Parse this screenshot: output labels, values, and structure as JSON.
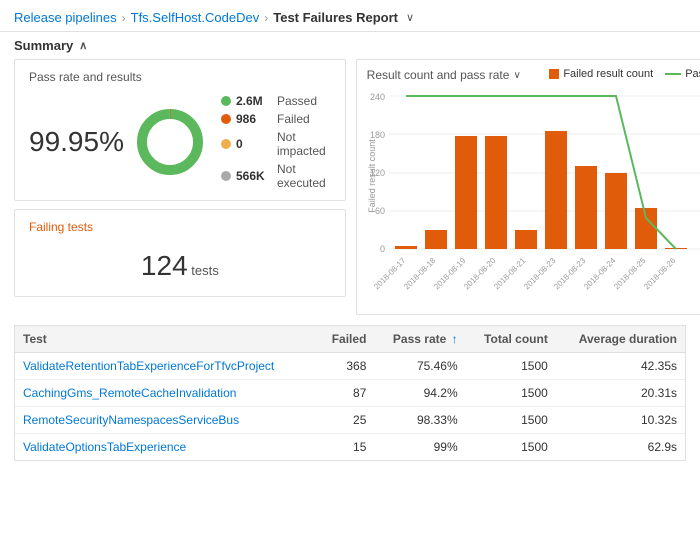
{
  "header": {
    "breadcrumb1": "Release pipelines",
    "breadcrumb2": "Tfs.SelfHost.CodeDev",
    "title": "Test Failures Report",
    "sep": "›"
  },
  "summary": {
    "label": "Summary",
    "chevron": "∧"
  },
  "passRate": {
    "title": "Pass rate and results",
    "percent": "99.95%",
    "legend": [
      {
        "color": "#5cb85c",
        "value": "2.6M",
        "label": "Passed"
      },
      {
        "color": "#e05c0a",
        "value": "986",
        "label": "Failed"
      },
      {
        "color": "#f0ad4e",
        "value": "0",
        "label": "Not impacted"
      },
      {
        "color": "#aaa",
        "value": "566K",
        "label": "Not executed"
      }
    ]
  },
  "failingTests": {
    "title": "Failing tests",
    "count": "124",
    "unit": "tests"
  },
  "chart": {
    "title": "Result count and pass rate",
    "legend": [
      {
        "type": "rect",
        "color": "#e05c0a",
        "label": "Failed result count"
      },
      {
        "type": "line",
        "color": "#5cb85c",
        "label": "Pass rate"
      }
    ],
    "yAxisLabel": "Failed result count",
    "y2AxisLabel": "",
    "bars": [
      {
        "date": "2018-08-17",
        "value": 5
      },
      {
        "date": "2018-08-18",
        "value": 30
      },
      {
        "date": "2018-08-19",
        "value": 178
      },
      {
        "date": "2018-08-20",
        "value": 178
      },
      {
        "date": "2018-08-21",
        "value": 30
      },
      {
        "date": "2018-08-23",
        "value": 185
      },
      {
        "date": "2018-08-23b",
        "value": 130
      },
      {
        "date": "2018-08-24",
        "value": 120
      },
      {
        "date": "2018-08-25",
        "value": 65
      },
      {
        "date": "2018-08-26",
        "value": 2
      }
    ],
    "passRateLine": [
      100,
      100,
      100,
      100,
      100,
      100,
      100,
      100,
      20,
      0
    ],
    "xLabels": [
      "2018-08-17",
      "2018-08-18",
      "2018-08-19",
      "2018-08-20",
      "2018-08-21",
      "2018-08-23",
      "2018-08-23",
      "2018-08-24",
      "2018-08-25",
      "2018-08-26"
    ],
    "yMax": 240,
    "y2Max": 100
  },
  "table": {
    "columns": [
      "Test",
      "Failed",
      "Pass rate",
      "",
      "Total count",
      "Average duration"
    ],
    "rows": [
      {
        "test": "ValidateRetentionTabExperienceForTfvcProject",
        "failed": "368",
        "passRate": "75.46%",
        "totalCount": "1500",
        "avgDuration": "42.35s"
      },
      {
        "test": "CachingGms_RemoteCacheInvalidation",
        "failed": "87",
        "passRate": "94.2%",
        "totalCount": "1500",
        "avgDuration": "20.31s"
      },
      {
        "test": "RemoteSecurityNamespacesServiceBus",
        "failed": "25",
        "passRate": "98.33%",
        "totalCount": "1500",
        "avgDuration": "10.32s"
      },
      {
        "test": "ValidateOptionsTabExperience",
        "failed": "15",
        "passRate": "99%",
        "totalCount": "1500",
        "avgDuration": "62.9s"
      }
    ]
  },
  "colors": {
    "passed": "#5cb85c",
    "failed": "#e05c0a",
    "notImpacted": "#f0ad4e",
    "notExecuted": "#aaa",
    "accent": "#0078d4"
  }
}
